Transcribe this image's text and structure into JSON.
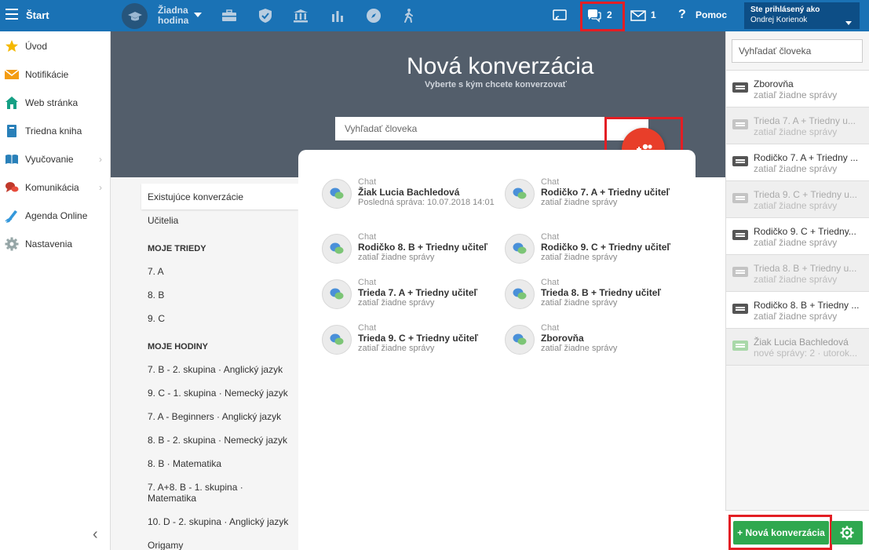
{
  "topbar": {
    "start_label": "Štart",
    "lesson_label_line1": "Žiadna",
    "lesson_label_line2": "hodina",
    "chat_count": "2",
    "mail_count": "1",
    "help_label": "Pomoc",
    "user_line1": "Ste prihlásený ako",
    "user_line2": "Ondrej Korienok",
    "icons": [
      "menu-icon",
      "graduation-cap-icon",
      "briefcase-icon",
      "shield-icon",
      "bank-icon",
      "bar-chart-icon",
      "compass-icon",
      "hiking-icon",
      "cast-icon",
      "chat-icon",
      "mail-icon",
      "help-icon"
    ]
  },
  "sidebar": {
    "items": [
      {
        "label": "Úvod",
        "icon": "star-icon"
      },
      {
        "label": "Notifikácie",
        "icon": "envelope-icon"
      },
      {
        "label": "Web stránka",
        "icon": "home-icon"
      },
      {
        "label": "Triedna kniha",
        "icon": "book-icon"
      },
      {
        "label": "Vyučovanie",
        "icon": "open-book-icon"
      },
      {
        "label": "Komunikácia",
        "icon": "chat-bubbles-icon"
      },
      {
        "label": "Agenda Online",
        "icon": "pen-icon"
      },
      {
        "label": "Nastavenia",
        "icon": "gear-icon"
      }
    ]
  },
  "header": {
    "title": "Nová konverzácia",
    "subtitle": "Vyberte s kým chcete konverzovať",
    "search_placeholder": "Vyhľadať človeka"
  },
  "conv_nav": {
    "existing": "Existujúce konverzácie",
    "teachers": "Učitelia",
    "my_classes_heading": "MOJE TRIEDY",
    "classes": [
      "7. A",
      "8. B",
      "9. C"
    ],
    "my_lessons_heading": "MOJE HODINY",
    "lessons": [
      "7. B - 2. skupina · Anglický jazyk",
      "9. C - 1. skupina · Nemecký jazyk",
      "7. A - Beginners · Anglický jazyk",
      "8. B - 2. skupina · Nemecký jazyk",
      "8. B · Matematika",
      "7. A+8. B - 1. skupina · Matematika",
      "10. D - 2. skupina · Anglický jazyk",
      "Origamy"
    ]
  },
  "chats": [
    {
      "type": "Chat",
      "name": "Žiak Lucia Bachledová",
      "sub": "Posledná správa: 10.07.2018 14:01"
    },
    {
      "type": "Chat",
      "name": "Rodičko 7. A + Triedny učiteľ",
      "sub": "zatiaľ žiadne správy"
    },
    {
      "type": "Chat",
      "name": "Rodičko 8. B + Triedny učiteľ",
      "sub": "zatiaľ žiadne správy"
    },
    {
      "type": "Chat",
      "name": "Rodičko 9. C + Triedny učiteľ",
      "sub": "zatiaľ žiadne správy"
    },
    {
      "type": "Chat",
      "name": "Trieda 7. A + Triedny učiteľ",
      "sub": "zatiaľ žiadne správy"
    },
    {
      "type": "Chat",
      "name": "Trieda 8. B + Triedny učiteľ",
      "sub": "zatiaľ žiadne správy"
    },
    {
      "type": "Chat",
      "name": "Trieda 9. C + Triedny učiteľ",
      "sub": "zatiaľ žiadne správy"
    },
    {
      "type": "Chat",
      "name": "Zborovňa",
      "sub": "zatiaľ žiadne správy"
    }
  ],
  "right_panel": {
    "search_placeholder": "Vyhľadať človeka",
    "items": [
      {
        "name": "Zborovňa",
        "sub": "zatiaľ žiadne správy",
        "state": "white"
      },
      {
        "name": "Trieda 7. A + Triedny u...",
        "sub": "zatiaľ žiadne správy",
        "state": "grey"
      },
      {
        "name": "Rodičko 7. A + Triedny ...",
        "sub": "zatiaľ žiadne správy",
        "state": "white"
      },
      {
        "name": "Trieda 9. C + Triedny u...",
        "sub": "zatiaľ žiadne správy",
        "state": "grey"
      },
      {
        "name": "Rodičko 9. C + Triedny...",
        "sub": "zatiaľ žiadne správy",
        "state": "white"
      },
      {
        "name": "Trieda 8. B + Triedny u...",
        "sub": "zatiaľ žiadne správy",
        "state": "grey"
      },
      {
        "name": "Rodičko 8. B + Triedny ...",
        "sub": "zatiaľ žiadne správy",
        "state": "white"
      },
      {
        "name": "Žiak Lucia Bachledová",
        "sub": "nové správy: 2 · utorok...",
        "state": "green"
      }
    ],
    "new_conversation_label": "+ Nová konverzácia"
  },
  "colors": {
    "topbar": "#1a72b5",
    "header_band": "#535e6b",
    "fab": "#e83e2a",
    "green_button": "#2fa84f",
    "highlight_border": "#e31e24"
  }
}
